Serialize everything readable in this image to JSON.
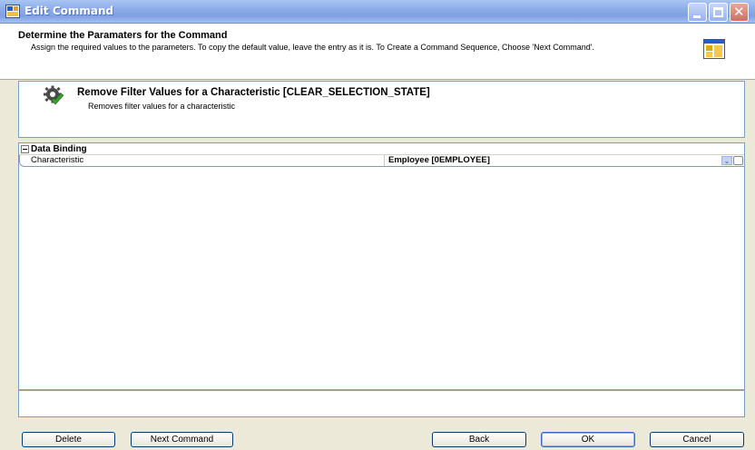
{
  "window": {
    "title": "Edit Command",
    "icon": "table-grid-icon"
  },
  "header": {
    "title": "Determine the Paramaters for the Command",
    "description": "Assign the required values to the parameters. To copy the default value, leave the entry as it is. To Create a Command Sequence, Choose 'Next Command'.",
    "icon": "command-wizard-icon"
  },
  "command": {
    "title": "Remove Filter Values for a Characteristic [CLEAR_SELECTION_STATE]",
    "description": "Removes filter values for a characteristic",
    "icon": "gear-check-icon"
  },
  "grid": {
    "category": "Data Binding",
    "rows": [
      {
        "name": "Characteristic",
        "value": "Employee [0EMPLOYEE]"
      }
    ]
  },
  "buttons": {
    "delete": "Delete",
    "next_command": "Next Command",
    "back": "Back",
    "ok": "OK",
    "cancel": "Cancel"
  },
  "colors": {
    "titlebar": "#8fb0ea",
    "dialog_bg": "#ece9d8",
    "border": "#7f9db9"
  }
}
